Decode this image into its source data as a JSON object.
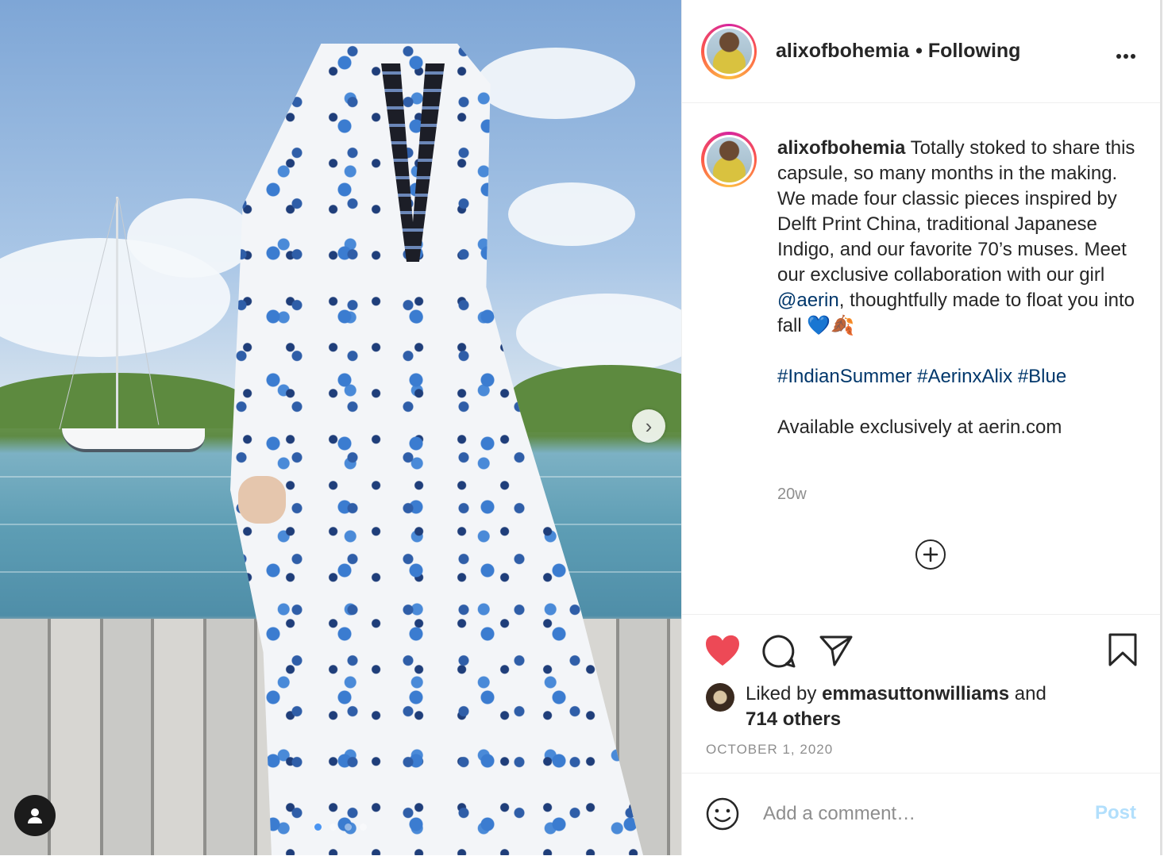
{
  "header": {
    "username": "alixofbohemia",
    "separator": "•",
    "follow_status": "Following",
    "more_icon": "more-horizontal-icon"
  },
  "caption": {
    "username": "alixofbohemia",
    "text_before_mention": " Totally stoked to share this capsule, so many months in the making. We made four classic pieces inspired by Delft Print China, traditional Japanese Indigo, and our favorite 70’s muses. Meet our exclusive collaboration with our girl ",
    "mention": "@aerin",
    "text_after_mention": ", thoughtfully made to float you into fall 💙🍂",
    "hashtags": [
      "#IndianSummer",
      "#AerinxAlix",
      "#Blue"
    ],
    "availability": "Available exclusively at aerin.com",
    "time_ago": "20w"
  },
  "actions": {
    "like_icon": "heart-filled-icon",
    "comment_icon": "comment-icon",
    "share_icon": "share-icon",
    "save_icon": "bookmark-icon",
    "liked_by_prefix": "Liked by ",
    "liked_by_user": "emmasuttonwilliams",
    "liked_by_suffix": " and",
    "others": "714 others",
    "date": "OCTOBER 1, 2020"
  },
  "comment": {
    "placeholder": "Add a comment…",
    "post_label": "Post"
  },
  "photo": {
    "next_label": "›",
    "carousel_count": 4,
    "carousel_active_index": 0
  },
  "colors": {
    "like": "#ed4956",
    "link": "#00376b",
    "post_disabled": "#b2dffc",
    "carousel_active": "#4a95f2"
  }
}
